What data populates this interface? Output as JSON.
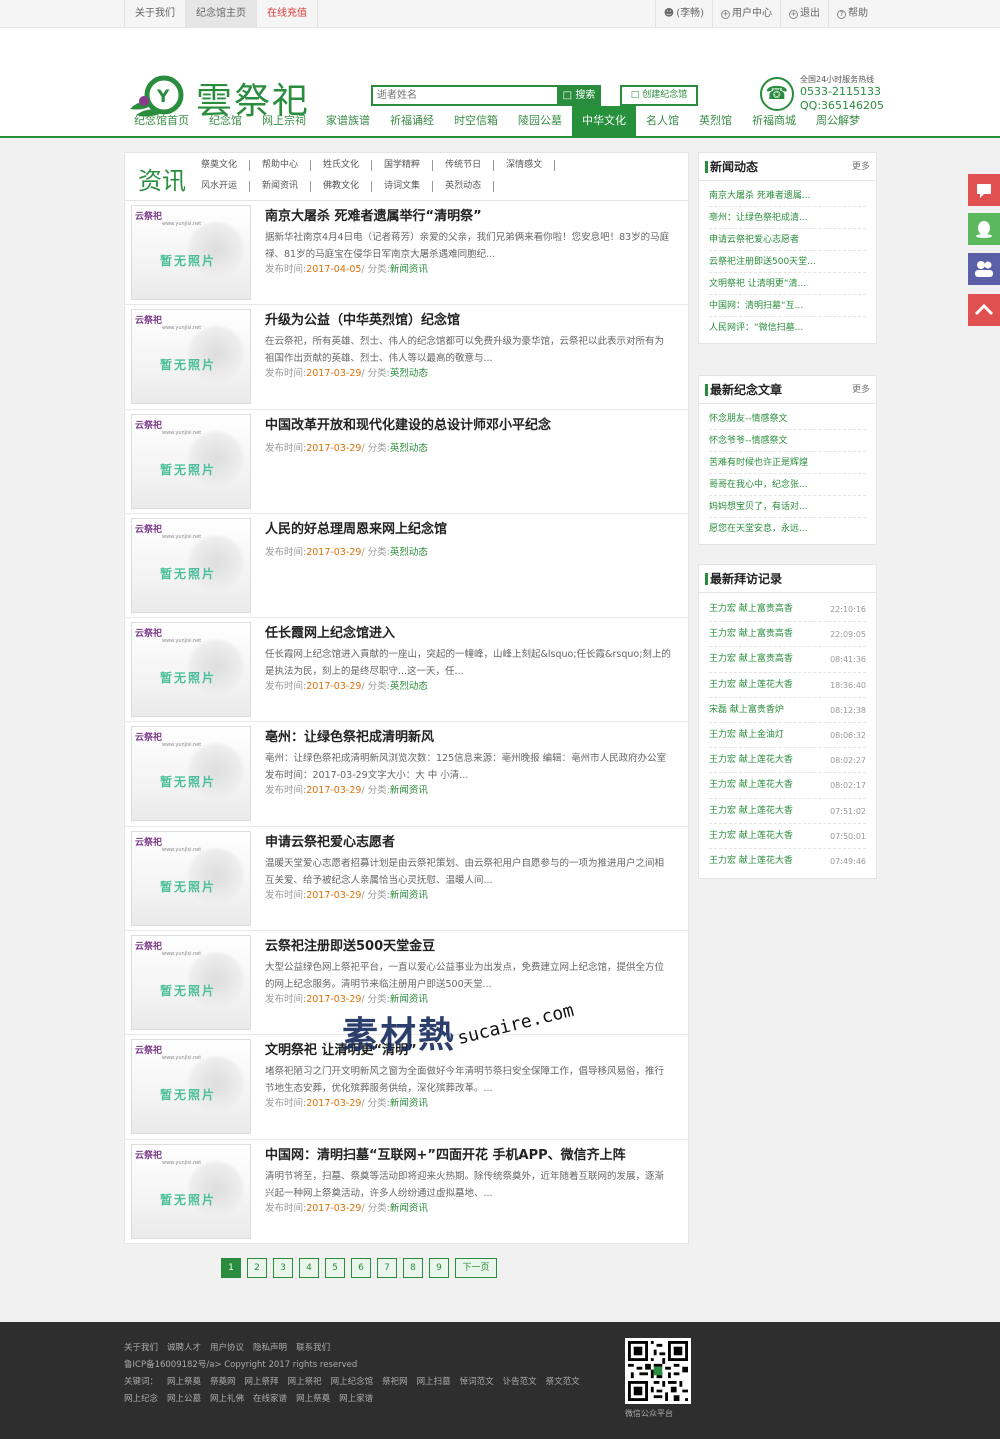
{
  "topbar": {
    "left": [
      "关于我们",
      "纪念馆主页",
      "在线充值"
    ],
    "user": "(李畅)",
    "user_center": "用户中心",
    "logout": "退出",
    "help": "帮助"
  },
  "header": {
    "logo_text": "雲祭祀",
    "search_placeholder": "逝者姓名",
    "search_btn": "搜索",
    "create_btn": "创建纪念馆",
    "hotline_label": "全国24小时服务热线",
    "phone": "0533-2115133",
    "qq": "QQ:365146205"
  },
  "nav": [
    "纪念馆首页",
    "纪念馆",
    "网上宗祠",
    "家谱族谱",
    "祈福诵经",
    "时空信箱",
    "陵园公墓",
    "中华文化",
    "名人馆",
    "英烈馆",
    "祈福商城",
    "周公解梦"
  ],
  "nav_active": "中华文化",
  "category": {
    "title": "资讯",
    "row1": [
      "祭奠文化",
      "帮助中心",
      "姓氏文化",
      "国学精粹",
      "传统节日",
      "深情感文"
    ],
    "row2": [
      "风水开运",
      "新闻资讯",
      "佛教文化",
      "诗词文集",
      "英烈动态"
    ]
  },
  "thumb": {
    "logo": "云祭祀",
    "url": "www.yunjisi.net",
    "nophoto": "暂无照片"
  },
  "meta_prefix": "发布时间:",
  "meta_class": "/ 分类:",
  "articles": [
    {
      "title": "南京大屠杀 死难者遗属举行“清明祭”",
      "desc": "据新华社南京4月4日电（记者蒋芳）亲爱的父亲，我们兄弟俩来看你啦！您安息吧！83岁的马庭禄、81岁的马庭宝在侵华日军南京大屠杀遇难同胞纪...",
      "date": "2017-04-05",
      "category": "新闻资讯"
    },
    {
      "title": "升级为公益（中华英烈馆）纪念馆",
      "desc": "在云祭祀，所有英雄、烈士、伟人的纪念馆都可以免费升级为豪华馆，云祭祀以此表示对所有为祖国作出贡献的英雄、烈士、伟人等以最高的敬意与...",
      "date": "2017-03-29",
      "category": "英烈动态"
    },
    {
      "title": "中国改革开放和现代化建设的总设计师邓小平纪念",
      "desc": "",
      "date": "2017-03-29",
      "category": "英烈动态"
    },
    {
      "title": "人民的好总理周恩来网上纪念馆",
      "desc": "",
      "date": "2017-03-29",
      "category": "英烈动态"
    },
    {
      "title": "任长霞网上纪念馆进入",
      "desc": "任长霞网上纪念馆进入貢献的一座山，突起的一幢峰，山峰上刻起&lsquo;任长霞&rsquo;刻上的是执法为民，刻上的是终尽职守...这一天，任...",
      "date": "2017-03-29",
      "category": "英烈动态"
    },
    {
      "title": "亳州：让绿色祭祀成清明新风",
      "desc": "亳州：让绿色祭祀成清明新风浏览次数：125信息来源：亳州晚报 编辑：亳州市人民政府办公室发布时间：2017-03-29文字大小：大 中 小清...",
      "date": "2017-03-29",
      "category": "新闻资讯"
    },
    {
      "title": "申请云祭祀爱心志愿者",
      "desc": "温暖天堂爱心志愿者招募计划是由云祭祀策划、由云祭祀用户自愿参与的一项为推进用户之间相互关爱、给予被纪念人亲属恰当心灵抚慰、温暖人间...",
      "date": "2017-03-29",
      "category": "新闻资讯"
    },
    {
      "title": "云祭祀注册即送500天堂金豆",
      "desc": "大型公益绿色网上祭祀平台，一直以爱心公益事业为出发点，免费建立网上纪念馆，提供全方位的网上纪念服务。清明节来临注册用户即送500天堂...",
      "date": "2017-03-29",
      "category": "新闻资讯"
    },
    {
      "title": "文明祭祀 让清明更“清明”",
      "desc": "堵祭祀陋习之门开文明新风之窗为全面做好今年清明节祭扫安全保障工作，倡导移风易俗，推行节地生态安葬，优化殡葬服务供给，深化殡葬改革。...",
      "date": "2017-03-29",
      "category": "新闻资讯"
    },
    {
      "title": "中国网：清明扫墓“互联网+”四面开花 手机APP、微信齐上阵",
      "desc": "清明节将至，扫墓、祭奠等活动即将迎来火热期。除传统祭奠外，近年随着互联网的发展，逐渐兴起一种网上祭奠活动，许多人纷纷通过虚拟墓地、...",
      "date": "2017-03-29",
      "category": "新闻资讯"
    }
  ],
  "pager": [
    "1",
    "2",
    "3",
    "4",
    "5",
    "6",
    "7",
    "8",
    "9",
    "下一页"
  ],
  "news": {
    "title": "新闻动态",
    "more": "更多",
    "items": [
      "南京大屠杀 死难者遗属...",
      "亳州：让绿色祭祀成清...",
      "申请云祭祀爱心志愿者",
      "云祭祀注册即送500天堂...",
      "文明祭祀 让清明更“清...",
      "中国网：清明扫墓“互...",
      "人民网评：“微信扫墓..."
    ]
  },
  "memorial": {
    "title": "最新纪念文章",
    "more": "更多",
    "items": [
      "怀念朋友--情感祭文",
      "怀念爷爷--情感祭文",
      "苦难有时候也许正是辉煌",
      "哥哥在我心中，纪念张...",
      "妈妈想宝贝了，有话对...",
      "愿您在天堂安息，永远..."
    ]
  },
  "visits": {
    "title": "最新拜访记录",
    "items": [
      {
        "text": "王力宏 献上富贵高香",
        "time": "22:10:16"
      },
      {
        "text": "王力宏 献上富贵高香",
        "time": "22:09:05"
      },
      {
        "text": "王力宏 献上富贵高香",
        "time": "08:41:36"
      },
      {
        "text": "王力宏 献上莲花大香",
        "time": "18:36:40"
      },
      {
        "text": "宋磊 献上富贵香炉",
        "time": "08:12:38"
      },
      {
        "text": "王力宏 献上金油灯",
        "time": "08:06:32"
      },
      {
        "text": "王力宏 献上莲花大香",
        "time": "08:02:27"
      },
      {
        "text": "王力宏 献上莲花大香",
        "time": "08:02:17"
      },
      {
        "text": "王力宏 献上莲花大香",
        "time": "07:51:02"
      },
      {
        "text": "王力宏 献上莲花大香",
        "time": "07:50:01"
      },
      {
        "text": "王力宏 献上莲花大香",
        "time": "07:49:46"
      }
    ]
  },
  "footer": {
    "links": [
      "关于我们",
      "诚聘人才",
      "用户协议",
      "隐私声明",
      "联系我们"
    ],
    "icp": "鲁ICP备16009182号/a> Copyright 2017 rights reserved",
    "kw_label": "关键词：",
    "kw1": [
      "网上祭奠",
      "祭奠网",
      "网上祭拜",
      "网上祭祀",
      "网上纪念馆",
      "祭祀网",
      "网上扫墓",
      "悼词范文",
      "讣告范文",
      "祭文范文"
    ],
    "kw2": [
      "网上纪念",
      "网上公墓",
      "网上礼佛",
      "在线家谱",
      "网上祭奠",
      "网上家谱"
    ],
    "qr_label": "微信公众平台"
  },
  "watermark": {
    "text": "素材熱",
    "url": "sucaire.com"
  },
  "colors": {
    "brand": "#2a8d3d",
    "accent": "#e0720c",
    "float_red": "#e05050",
    "float_green": "#5cb85c",
    "float_purple": "#5a5fa8"
  }
}
